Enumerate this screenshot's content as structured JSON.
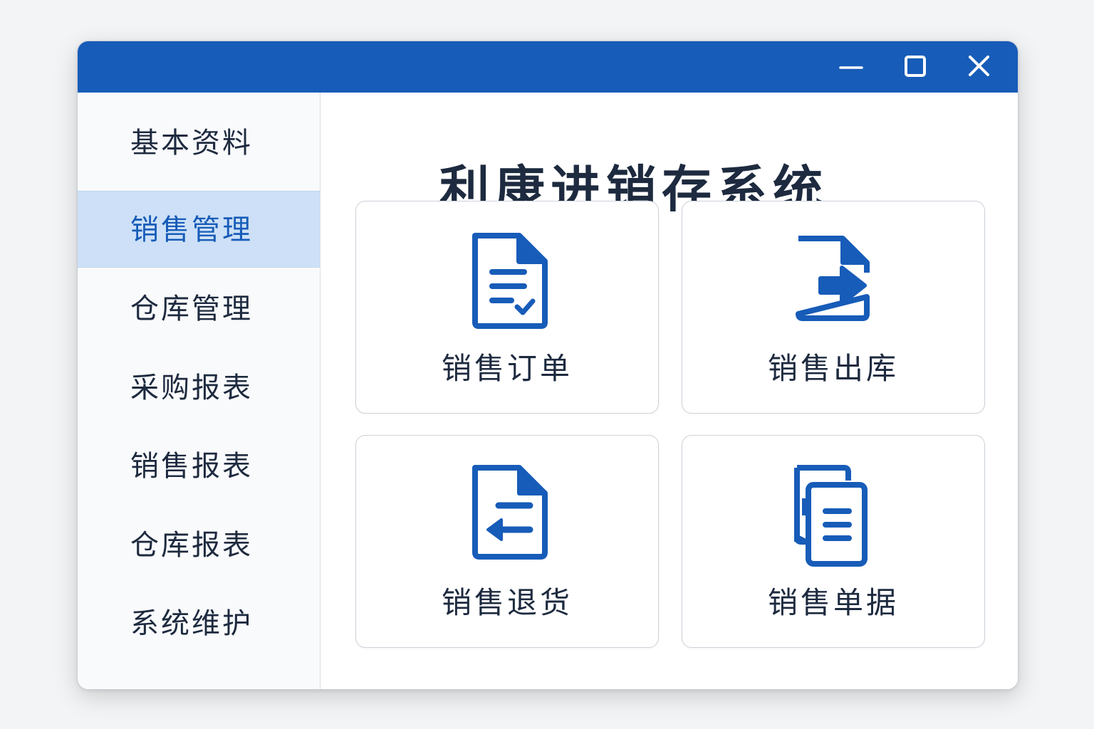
{
  "window": {
    "title": "",
    "controls": {
      "minimize_icon": "minimize-icon",
      "maximize_icon": "maximize-icon",
      "close_icon": "close-icon"
    }
  },
  "sidebar": {
    "items": [
      {
        "label": "基本资料",
        "active": false
      },
      {
        "label": "销售管理",
        "active": true
      },
      {
        "label": "仓库管理",
        "active": false
      },
      {
        "label": "采购报表",
        "active": false
      },
      {
        "label": "销售报表",
        "active": false
      },
      {
        "label": "仓库报表",
        "active": false
      },
      {
        "label": "系统维护",
        "active": false
      }
    ]
  },
  "main": {
    "title": "利康进销存系统",
    "cards": [
      {
        "label": "销售订单",
        "icon": "document-check-icon"
      },
      {
        "label": "销售出库",
        "icon": "document-export-icon"
      },
      {
        "label": "销售退货",
        "icon": "document-return-icon"
      },
      {
        "label": "销售单据",
        "icon": "documents-copy-icon"
      }
    ]
  },
  "colors": {
    "accent": "#175cb8",
    "active_background": "#cde0f7",
    "text_primary": "#1d2a3f",
    "page_background": "#f3f4f6"
  }
}
